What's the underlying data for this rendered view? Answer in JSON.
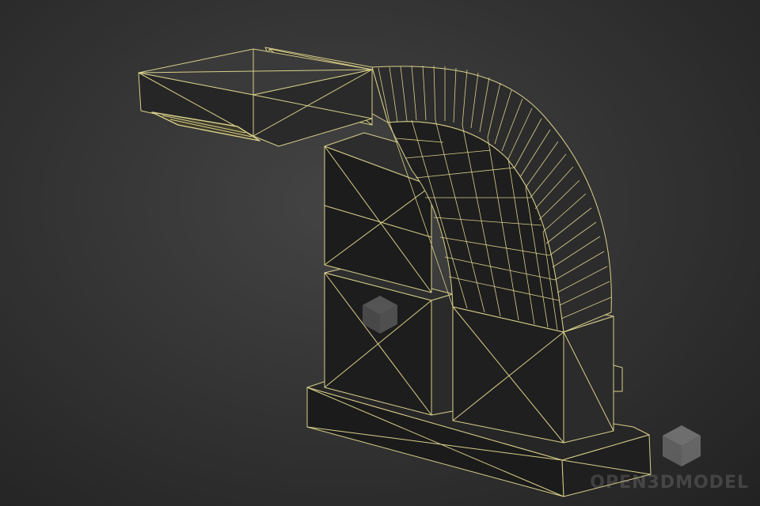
{
  "image": {
    "subject": "wireframe-render",
    "colors": {
      "background": "#333333",
      "wire": "#d8cf8a",
      "face_light": "#3a3a3a",
      "face_dark": "#1e1e1e",
      "watermark": "#9a9a9a"
    }
  },
  "watermark": {
    "text": "OPEN3DMODEL",
    "icon": "cube-logo-icon"
  }
}
